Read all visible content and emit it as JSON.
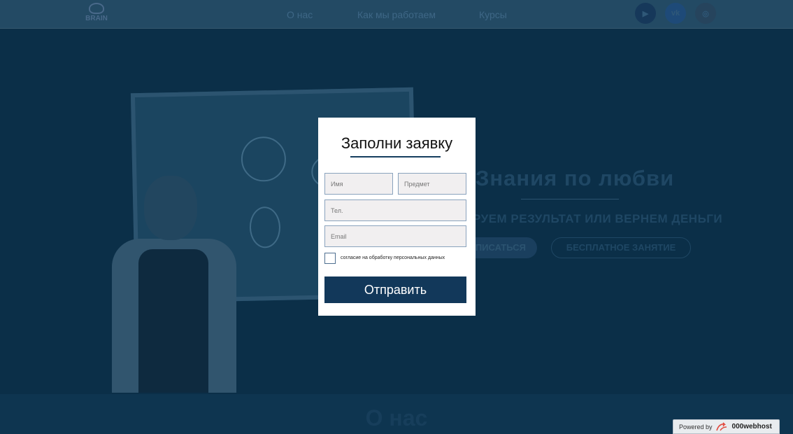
{
  "nav": {
    "logo_text": "BRAIN",
    "links": [
      "О нас",
      "Как мы работаем",
      "Курсы"
    ],
    "social": [
      {
        "icon": "youtube-icon",
        "glyph": "▶"
      },
      {
        "icon": "vk-icon",
        "glyph": "vk"
      },
      {
        "icon": "instagram-icon",
        "glyph": "◎"
      }
    ]
  },
  "hero": {
    "title": "Знания по любви",
    "subtitle": "руем результат или вернем деньги",
    "btn_signup": "писаться",
    "btn_free": "Бесплатное занятие"
  },
  "about": {
    "title": "О нас"
  },
  "modal": {
    "title": "Заполни заявку",
    "name_placeholder": "Имя",
    "subject_placeholder": "Предмет",
    "phone_placeholder": "Тел.",
    "email_placeholder": "Email",
    "consent_label": "согласие на обработку персональных данных",
    "consent_checked": false,
    "submit_label": "Отправить"
  },
  "badge": {
    "powered_by": "Powered by",
    "brand": "000webhost"
  },
  "colors": {
    "overlay_bg": "#0b2f48",
    "button": "#12385a",
    "field_bg": "#f1eff0",
    "field_border": "#8aa3bd"
  }
}
